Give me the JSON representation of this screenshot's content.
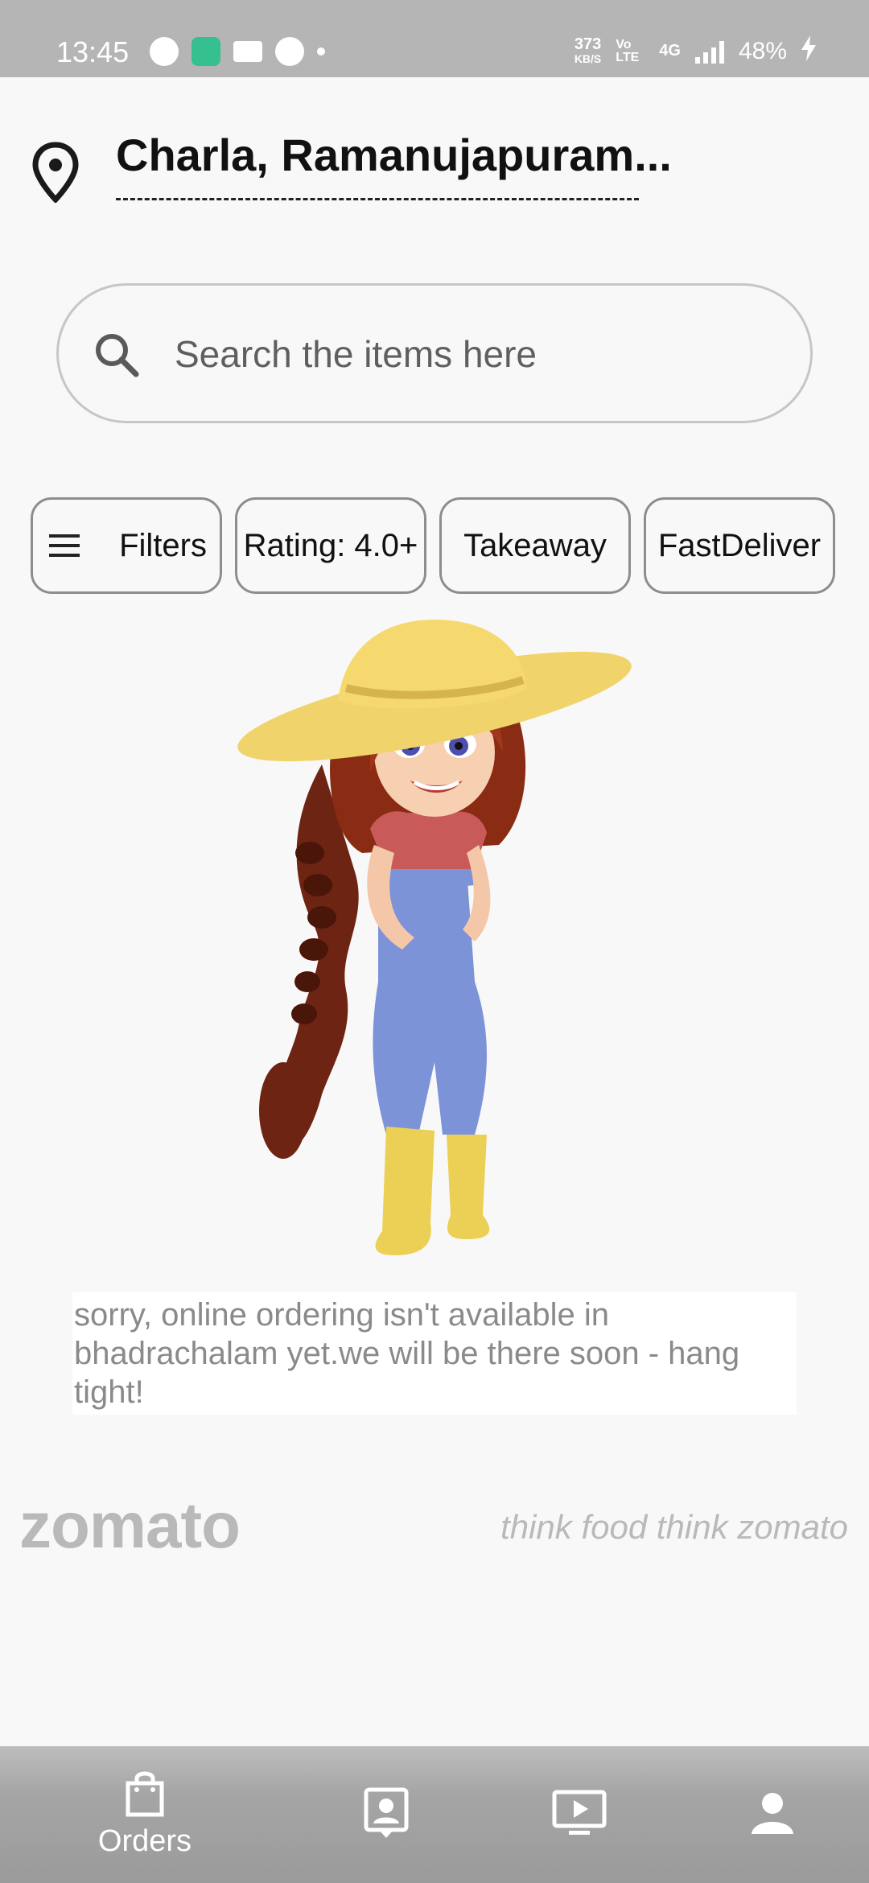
{
  "status_bar": {
    "time": "13:45",
    "speed_value": "373",
    "speed_unit": "KB/S",
    "volte": "Vo LTE",
    "network": "4G",
    "battery": "48%"
  },
  "header": {
    "location": "Charla, Ramanujapuram..."
  },
  "search": {
    "placeholder": "Search the items here"
  },
  "filters": {
    "chips": [
      "Filters",
      "Rating: 4.0+",
      "Takeaway",
      "FastDeliver"
    ]
  },
  "message": "sorry, online ordering isn't available in bhadrachalam yet.we will be there soon - hang tight!",
  "brand": {
    "name": "zomato",
    "tagline": "think food think zomato"
  },
  "bottom_nav": {
    "items": [
      {
        "label": "Orders",
        "icon": "shopping-bag-icon"
      },
      {
        "label": "",
        "icon": "contact-card-icon"
      },
      {
        "label": "",
        "icon": "video-play-icon"
      },
      {
        "label": "",
        "icon": "profile-icon"
      }
    ]
  }
}
